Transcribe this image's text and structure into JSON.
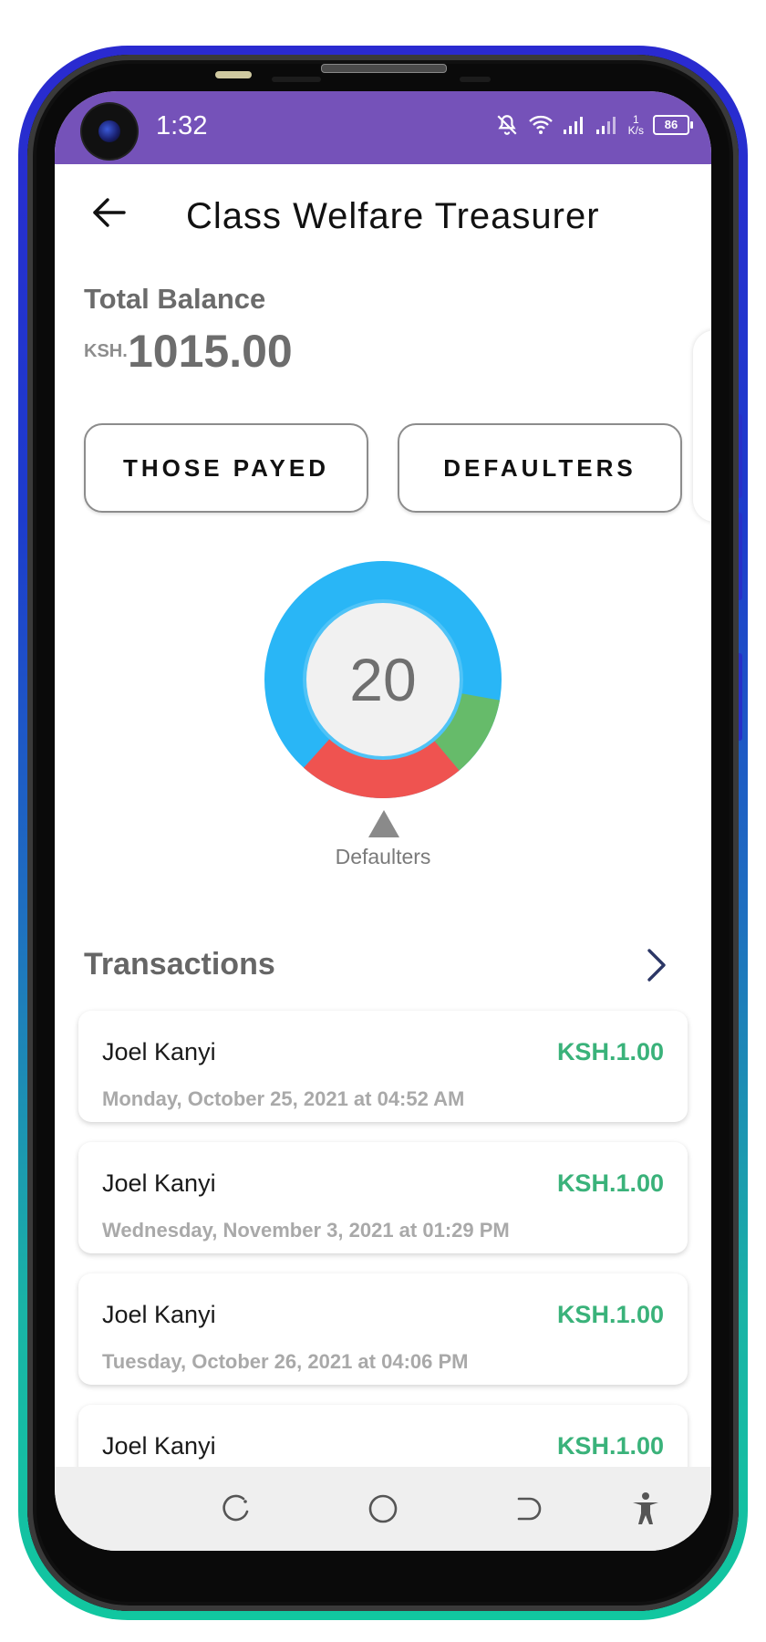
{
  "status_bar": {
    "time": "1:32",
    "net_speed_value": "1",
    "net_speed_unit": "K/s",
    "battery": "86",
    "background_color": "#7552b9"
  },
  "header": {
    "title": "Class Welfare Treasurer",
    "back_icon": "arrow-left-icon"
  },
  "balance": {
    "label": "Total Balance",
    "currency": "KSH.",
    "amount": "1015.00"
  },
  "actions": {
    "payed_label": "THOSE PAYED",
    "defaulters_label": "DEFAULTERS"
  },
  "summary_chart": {
    "center_value": "20",
    "pointer_label": "Defaulters",
    "colors": {
      "payed": "#29b6f6",
      "green_segment": "#66bb6a",
      "defaulters": "#ef5350"
    }
  },
  "transactions": {
    "title": "Transactions",
    "items": [
      {
        "name": "Joel Kanyi",
        "amount": "KSH.1.00",
        "date": "Monday, October 25, 2021 at 04:52 AM"
      },
      {
        "name": "Joel Kanyi",
        "amount": "KSH.1.00",
        "date": "Wednesday, November 3, 2021 at 01:29 PM"
      },
      {
        "name": "Joel Kanyi",
        "amount": "KSH.1.00",
        "date": "Tuesday, October 26, 2021 at 04:06 PM"
      },
      {
        "name": "Joel Kanyi",
        "amount": "KSH.1.00"
      }
    ]
  },
  "nav_bar": {
    "icons": [
      "recent-apps-icon",
      "home-icon",
      "back-nav-icon",
      "accessibility-icon"
    ]
  }
}
